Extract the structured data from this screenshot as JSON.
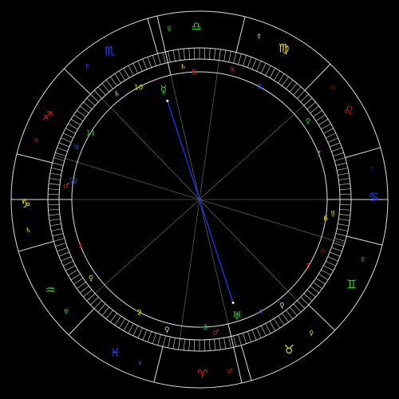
{
  "colors": {
    "background": "#000000",
    "line": "#dddddd",
    "aspect": "#1a2fd6",
    "fire": "#e02020",
    "earth": "#e8e020",
    "air": "#30d030",
    "water": "#2040ff"
  },
  "signs": [
    {
      "glyph": "♎",
      "name": "libra-icon",
      "color": "#30d030"
    },
    {
      "glyph": "♍",
      "name": "virgo-icon",
      "color": "#e8e020"
    },
    {
      "glyph": "♌",
      "name": "leo-icon",
      "color": "#e02020"
    },
    {
      "glyph": "♋",
      "name": "cancer-icon",
      "color": "#2040ff"
    },
    {
      "glyph": "♊",
      "name": "gemini-icon",
      "color": "#30d030"
    },
    {
      "glyph": "♉",
      "name": "taurus-icon",
      "color": "#e8e020"
    },
    {
      "glyph": "♈",
      "name": "aries-icon",
      "color": "#e02020"
    },
    {
      "glyph": "♓",
      "name": "pisces-icon",
      "color": "#2040ff"
    },
    {
      "glyph": "♒",
      "name": "aquarius-icon",
      "color": "#30d030"
    },
    {
      "glyph": "♑",
      "name": "capricorn-icon",
      "color": "#e8e020"
    },
    {
      "glyph": "♐",
      "name": "sagittarius-icon",
      "color": "#e02020"
    },
    {
      "glyph": "♏",
      "name": "scorpio-icon",
      "color": "#2040ff"
    }
  ],
  "houses": [
    "1",
    "2",
    "3",
    "4",
    "5",
    "6",
    "7",
    "8",
    "9",
    "10",
    "11",
    "12"
  ],
  "planets": [
    {
      "glyph": "☿",
      "name": "mercury-icon",
      "color": "#30d030"
    },
    {
      "glyph": "♅",
      "name": "uranus-icon",
      "color": "#30d030"
    },
    {
      "glyph": "♀",
      "name": "venus-icon",
      "color": "#e8e020"
    },
    {
      "glyph": "☊",
      "name": "node-icon",
      "color": "#e8e020"
    }
  ],
  "rulers": [
    {
      "glyph": "♀",
      "color": "#30d030"
    },
    {
      "glyph": "☿",
      "color": "#e8e020"
    },
    {
      "glyph": "☉",
      "color": "#e02020"
    },
    {
      "glyph": "☽",
      "color": "#2040ff"
    },
    {
      "glyph": "☿",
      "color": "#30d030"
    },
    {
      "glyph": "♀",
      "color": "#e8e020"
    },
    {
      "glyph": "♂",
      "color": "#e02020"
    },
    {
      "glyph": "♆",
      "color": "#2040ff"
    },
    {
      "glyph": "♅",
      "color": "#30d030"
    },
    {
      "glyph": "♄",
      "color": "#e8e020"
    },
    {
      "glyph": "♃",
      "color": "#e02020"
    },
    {
      "glyph": "♇",
      "color": "#2040ff"
    }
  ],
  "cusp_rulers": [
    {
      "glyph": "♂",
      "color": "#e02020"
    },
    {
      "glyph": "♀",
      "color": "#e8e020"
    },
    {
      "glyph": "♀",
      "color": "#e8e020"
    },
    {
      "glyph": "♂",
      "color": "#e02020"
    },
    {
      "glyph": "♀",
      "color": "#e8e020"
    },
    {
      "glyph": "☉",
      "color": "#e02020"
    },
    {
      "glyph": "☿",
      "color": "#e8e020"
    },
    {
      "glyph": "♀",
      "color": "#30d030"
    },
    {
      "glyph": "♃",
      "color": "#e02020"
    },
    {
      "glyph": "♄",
      "color": "#e8e020"
    },
    {
      "glyph": "♄",
      "color": "#e8e020"
    },
    {
      "glyph": "♃",
      "color": "#2040ff"
    }
  ]
}
